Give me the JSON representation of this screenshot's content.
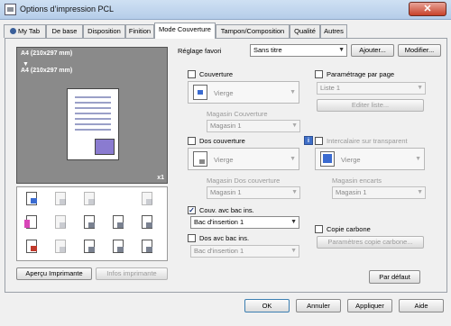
{
  "window": {
    "title": "Options d’impression PCL",
    "close_glyph": "✕"
  },
  "tabs": [
    {
      "label": "My Tab"
    },
    {
      "label": "De base"
    },
    {
      "label": "Disposition"
    },
    {
      "label": "Finition"
    },
    {
      "label": "Mode Couverture"
    },
    {
      "label": "Tampon/Composition"
    },
    {
      "label": "Qualité"
    },
    {
      "label": "Autres"
    }
  ],
  "preview": {
    "paper_line1": "A4 (210x297 mm)",
    "arrow": "▼",
    "paper_line2": "A4 (210x297 mm)",
    "count": "x1"
  },
  "left_buttons": {
    "printer_view": "Aperçu Imprimante",
    "printer_info": "Infos imprimante"
  },
  "favorite": {
    "label": "Réglage favori",
    "value": "Sans titre",
    "add_button": "Ajouter...",
    "modify_button": "Modifier..."
  },
  "cover": {
    "label": "Couverture",
    "paper_type": "Vierge",
    "tray_label": "Magasin Couverture",
    "tray_value": "Magasin 1"
  },
  "back_cover": {
    "label": "Dos couverture",
    "paper_type": "Vierge",
    "tray_label": "Magasin Dos couverture",
    "tray_value": "Magasin 1"
  },
  "insert_tray_cover": {
    "label": "Couv. avc bac ins.",
    "checked": true,
    "value": "Bac d'insertion 1"
  },
  "insert_tray_back": {
    "label": "Dos avc bac ins.",
    "checked": false,
    "value": "Bac d'insertion 1"
  },
  "per_page": {
    "label": "Paramétrage par page",
    "list_value": "Liste 1",
    "edit_button": "Editer liste..."
  },
  "transparency": {
    "label": "Intercalaire sur transparent",
    "paper_type": "Vierge",
    "tray_label": "Magasin encarts",
    "tray_value": "Magasin 1",
    "info_glyph": "i"
  },
  "carbon": {
    "label": "Copie carbone",
    "settings_button": "Paramètres copie carbone..."
  },
  "defaults_button": "Par défaut",
  "footer": {
    "ok": "OK",
    "cancel": "Annuler",
    "apply": "Appliquer",
    "help": "Aide"
  },
  "colors": {
    "accent_blue": "#3b6bd0",
    "accent_magenta": "#d846b8",
    "titlebar": "#b5cde9"
  }
}
